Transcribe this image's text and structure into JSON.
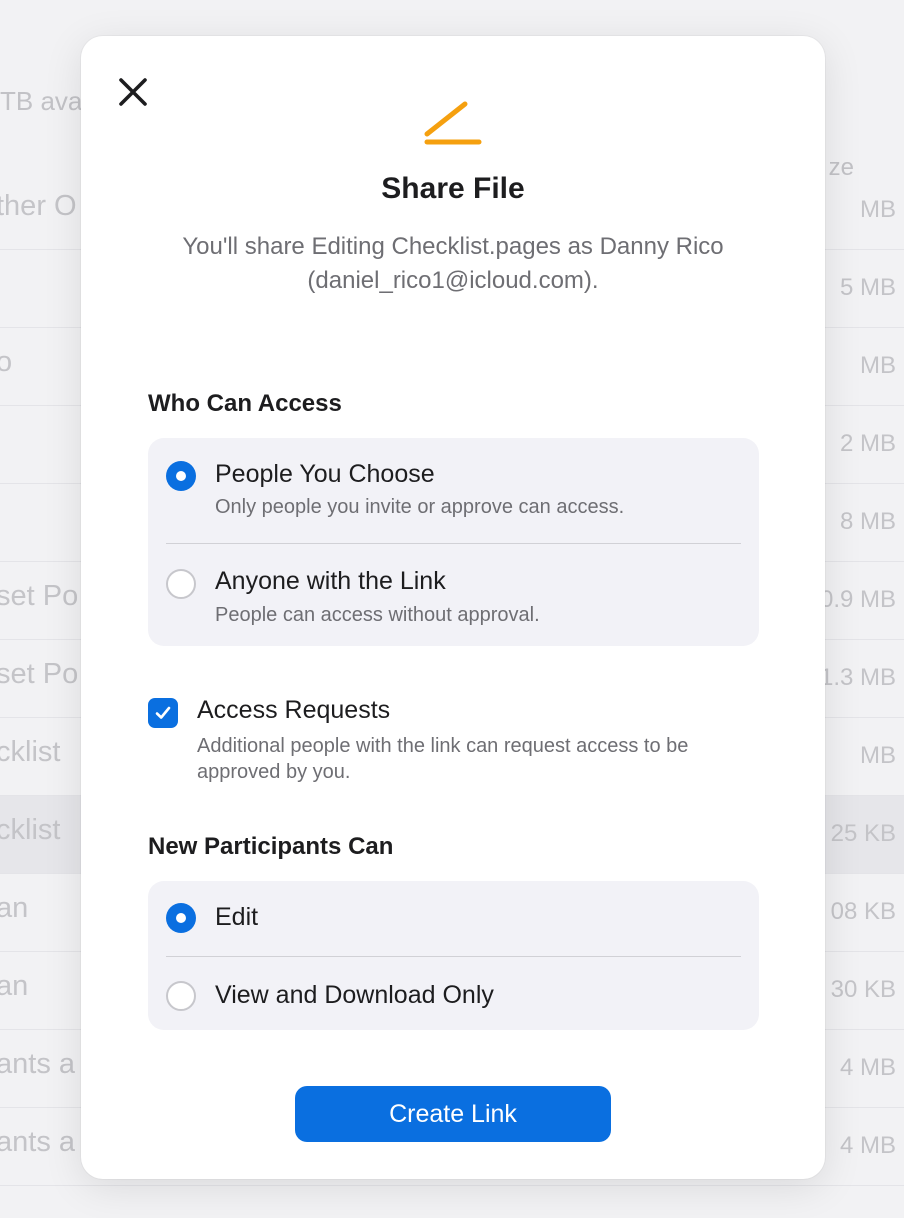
{
  "background": {
    "storage_text": "TB avail",
    "size_header": "ze",
    "rows": [
      {
        "name": "ther O",
        "size": "MB"
      },
      {
        "name": "",
        "size": "5 MB"
      },
      {
        "name": "o",
        "size": "MB"
      },
      {
        "name": "",
        "size": "2 MB"
      },
      {
        "name": "",
        "size": "8 MB"
      },
      {
        "name": "set Po",
        "size": "0.9 MB"
      },
      {
        "name": "set Po",
        "size": "1.3 MB"
      },
      {
        "name": "cklist",
        "size": "MB"
      },
      {
        "name": "cklist",
        "size": "25 KB"
      },
      {
        "name": "an",
        "size": "08 KB"
      },
      {
        "name": "an",
        "size": "30 KB"
      },
      {
        "name": "ants a",
        "size": "4 MB"
      },
      {
        "name": "ants a",
        "size": "4 MB"
      }
    ]
  },
  "dialog": {
    "icons": {
      "close": "close-icon",
      "header": "pencil-icon"
    },
    "title": "Share File",
    "subtitle": "You'll share Editing Checklist.pages as Danny Rico (daniel_rico1@icloud.com).",
    "access": {
      "label": "Who Can Access",
      "options": [
        {
          "title": "People You Choose",
          "desc": "Only people you invite or approve can access.",
          "selected": true
        },
        {
          "title": "Anyone with the Link",
          "desc": "People can access without approval.",
          "selected": false
        }
      ]
    },
    "requests": {
      "title": "Access Requests",
      "desc": "Additional people with the link can request access to be approved by you.",
      "checked": true
    },
    "participants": {
      "label": "New Participants Can",
      "options": [
        {
          "title": "Edit",
          "selected": true
        },
        {
          "title": "View and Download Only",
          "selected": false
        }
      ]
    },
    "create_button": "Create Link"
  },
  "colors": {
    "accent": "#0a6fe0",
    "icon": "#f5a00f"
  }
}
